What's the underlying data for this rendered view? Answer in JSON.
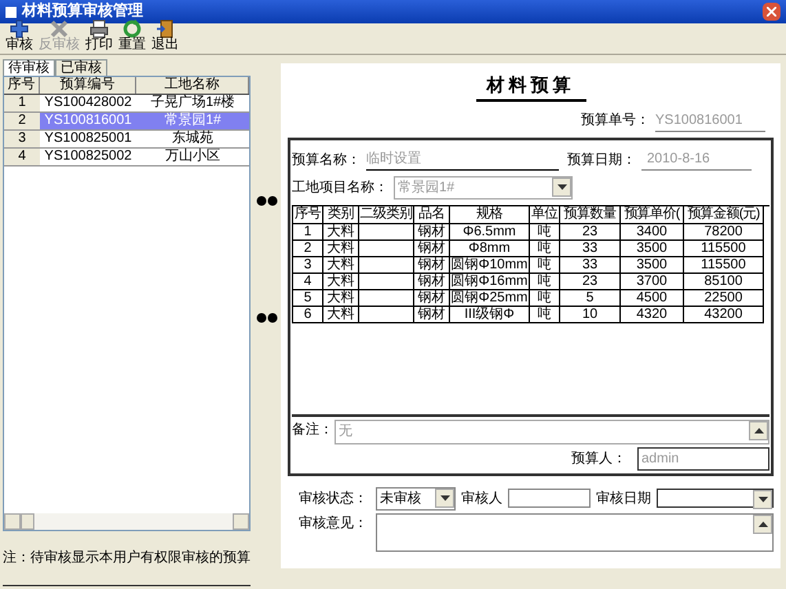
{
  "window": {
    "title": "材料预算审核管理"
  },
  "toolbar": [
    {
      "label": "审核",
      "kind": "audit",
      "disabled": false
    },
    {
      "label": "反审核",
      "kind": "unaudit",
      "disabled": true
    },
    {
      "label": "打印",
      "kind": "print",
      "disabled": false
    },
    {
      "label": "重置",
      "kind": "reset",
      "disabled": false
    },
    {
      "label": "退出",
      "kind": "exit",
      "disabled": false
    }
  ],
  "tabs": [
    {
      "label": "待审核",
      "selected": true
    },
    {
      "label": "已审核",
      "selected": false
    }
  ],
  "list": {
    "columns": [
      "序号",
      "预算编号",
      "工地名称"
    ],
    "rows": [
      {
        "cells": [
          "1",
          "YS100428002",
          "子晃广场1#楼"
        ],
        "selected": false
      },
      {
        "cells": [
          "2",
          "YS100816001",
          "常景园1#"
        ],
        "selected": true
      },
      {
        "cells": [
          "3",
          "YS100825001",
          "东城苑"
        ],
        "selected": false
      },
      {
        "cells": [
          "4",
          "YS100825002",
          "万山小区"
        ],
        "selected": false
      }
    ]
  },
  "note": "注：待审核显示本用户有权限审核的预算",
  "document": {
    "title": "材料预算",
    "number_label": "预算单号：",
    "number": "YS100816001",
    "name_label": "预算名称：",
    "name": "临时设置",
    "date_label": "预算日期：",
    "date": "2010-8-16",
    "site_label": "工地项目名称：",
    "site": "常景园1#",
    "columns": [
      "序号",
      "类别",
      "二级类别",
      "品名",
      "规格",
      "单位",
      "预算数量",
      "预算单价(",
      "预算金额(元)"
    ],
    "rows": [
      [
        "1",
        "大料",
        "",
        "钢材",
        "Φ6.5mm",
        "吨",
        "23",
        "3400",
        "78200"
      ],
      [
        "2",
        "大料",
        "",
        "钢材",
        "Φ8mm",
        "吨",
        "33",
        "3500",
        "115500"
      ],
      [
        "3",
        "大料",
        "",
        "钢材",
        "圆钢Φ10mm",
        "吨",
        "33",
        "3500",
        "115500"
      ],
      [
        "4",
        "大料",
        "",
        "钢材",
        "圆钢Φ16mm",
        "吨",
        "23",
        "3700",
        "85100"
      ],
      [
        "5",
        "大料",
        "",
        "钢材",
        "圆钢Φ25mm",
        "吨",
        "5",
        "4500",
        "22500"
      ],
      [
        "6",
        "大料",
        "",
        "钢材",
        "III级钢Φ",
        "吨",
        "10",
        "4320",
        "43200"
      ]
    ],
    "remark_label": "备注：",
    "remark": "无",
    "maker_label": "预算人：",
    "maker": "admin"
  },
  "audit": {
    "status_label": "审核状态：",
    "status": "未审核",
    "auditor_label": "审核人",
    "date_label": "审核日期",
    "opinion_label": "审核意见："
  }
}
